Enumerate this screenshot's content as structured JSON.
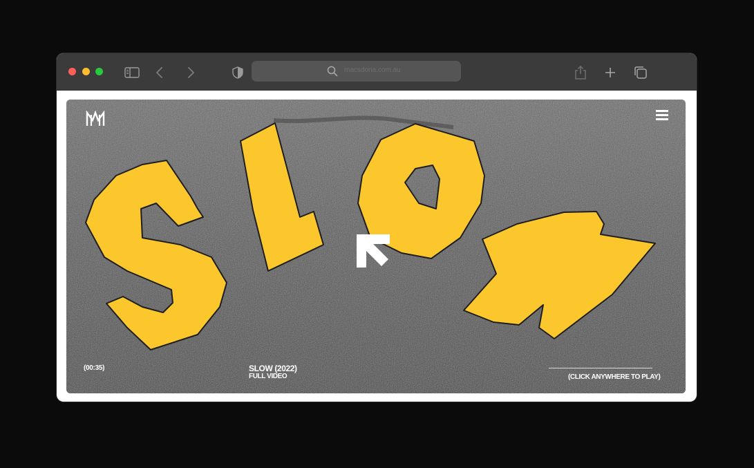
{
  "browser": {
    "url": "macsdona.com.au",
    "traffic_lights": [
      "close",
      "minimize",
      "zoom"
    ],
    "colors": {
      "toolbar": "#3b3b3b",
      "address_bar": "#555555"
    }
  },
  "page": {
    "video": {
      "duration": "(00:35)",
      "title": "SLOW (2022)",
      "subtitle": "FULL VIDEO",
      "cta": "(CLICK ANYWHERE TO PLAY)",
      "road_text": "SLOW"
    },
    "colors": {
      "road_marking": "#fcc72c",
      "asphalt": "#5a5a5a",
      "overlay_text": "#ffffff"
    }
  }
}
